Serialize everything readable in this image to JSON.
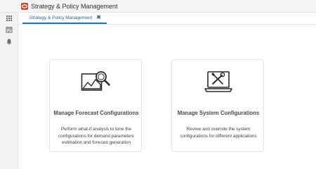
{
  "app": {
    "title": "Strategy & Policy Management",
    "brand_color": "#c74634"
  },
  "rail": {
    "icons": [
      "menu-icon",
      "apps-grid-icon",
      "calendar-icon",
      "bell-icon"
    ]
  },
  "tabs": [
    {
      "label": "Strategy & Policy Management",
      "close_symbol": "✖"
    }
  ],
  "cards": [
    {
      "title": "Manage Forecast Configurations",
      "description": "Perform what-if analysis to tune the configurations for demand parameters estimation and forecast generation",
      "icon": "chart-magnifier-icon"
    },
    {
      "title": "Manage System Configurations",
      "description": "Review and override the system configurations for different applications",
      "icon": "laptop-tools-icon"
    }
  ],
  "colors": {
    "accent": "#2a6eb3",
    "card_border": "#e4e4e4"
  }
}
